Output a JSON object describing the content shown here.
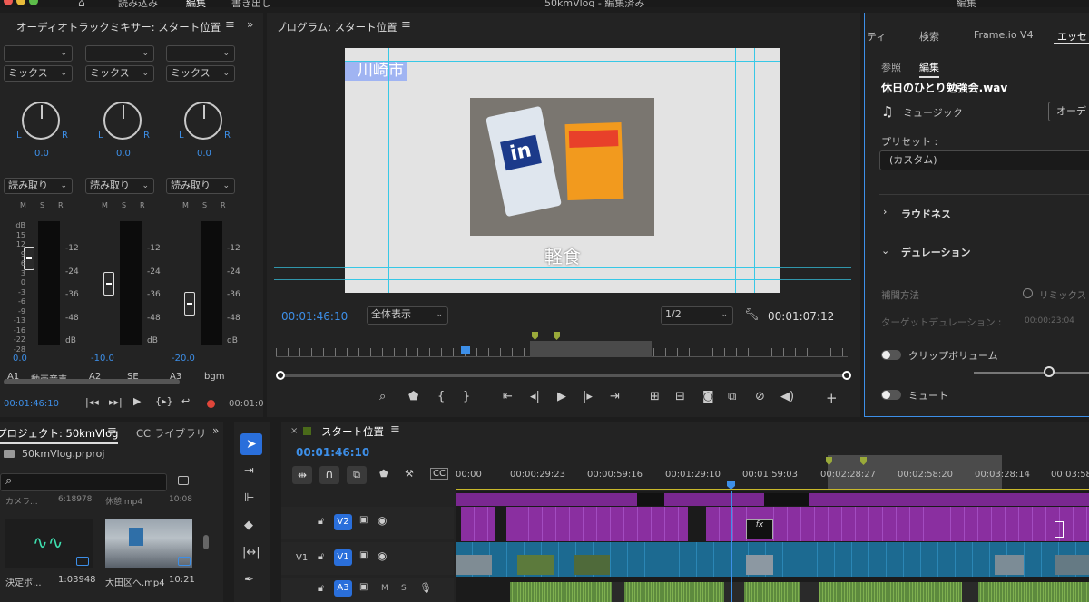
{
  "topbar": {
    "tabs": [
      "読み込み",
      "編集",
      "書き出し"
    ],
    "active_tab": "編集",
    "title": "50kmVlog - 編集済み",
    "right_label": "編集"
  },
  "mixer": {
    "title": "オーディオトラックミキサー: スタート位置",
    "mode_label": "ミックス",
    "read_label": "読み取り",
    "msr": [
      "M",
      "S",
      "R"
    ],
    "pan_values": [
      "0.0",
      "0.0",
      "0.0"
    ],
    "db_left": [
      "dB",
      "15",
      "12",
      "9",
      "6",
      "3",
      "0",
      "-3",
      "-6",
      "-9",
      "-13",
      "-16",
      "-22",
      "-28",
      "-oo"
    ],
    "db_right": [
      "-12",
      "-24",
      "-36",
      "-48",
      "dB"
    ],
    "channels": [
      {
        "volume": "0.0",
        "track": "A1",
        "name": "動画音声",
        "fader": 0.73
      },
      {
        "volume": "-10.0",
        "track": "A2",
        "name": "SE",
        "fader": 0.4
      },
      {
        "volume": "-20.0",
        "track": "A3",
        "name": "bgm",
        "fader": 0.15
      }
    ],
    "timecode": "00:01:46:10",
    "end_timecode": "00:01:0"
  },
  "program": {
    "title": "プログラム: スタート位置",
    "overlay_title": "川崎市",
    "caption": "軽食",
    "timecode": "00:01:46:10",
    "fit_label": "全体表示",
    "resolution": "1/2",
    "duration": "00:01:07:12",
    "playhead": 0.53
  },
  "essential": {
    "tabs": [
      "ティ",
      "検索",
      "Frame.io V4",
      "エッセ"
    ],
    "subtabs": [
      "参照",
      "編集"
    ],
    "filename": "休日のひとり勉強会.wav",
    "type_label": "ミュージック",
    "type_button": "オーデ",
    "preset_label": "プリセット :",
    "preset_value": "(カスタム)",
    "loudness": "ラウドネス",
    "duration_section": "デュレーション",
    "interp_label": "補間方法",
    "interp_option": "リミックス",
    "target_label": "ターゲットデュレーション :",
    "target_value": "00:00:23:04",
    "clip_volume": "クリップボリューム",
    "mute": "ミュート"
  },
  "project": {
    "tabs": [
      "プロジェクト: 50kmVlog",
      "CC ライブラリ"
    ],
    "file": "50kmVlog.prproj",
    "partial_labels": [
      "カメラ...",
      "6:18978",
      "休憩.mp4",
      "10:08"
    ],
    "items": [
      {
        "name": "決定ボ...",
        "meta": "1:03948"
      },
      {
        "name": "大田区へ.mp4",
        "meta": "10:21"
      }
    ]
  },
  "timeline": {
    "title": "スタート位置",
    "timecode": "00:01:46:10",
    "ruler": [
      "00:00",
      "00:00:29:23",
      "00:00:59:16",
      "00:01:29:10",
      "00:01:59:03",
      "00:02:28:27",
      "00:02:58:20",
      "00:03:28:14",
      "00:03:58"
    ],
    "tracks": [
      {
        "id": "V2",
        "label": "V2",
        "toggle": ""
      },
      {
        "id": "V1",
        "label": "V1",
        "toggle": "V1"
      },
      {
        "id": "A3",
        "label": "A3",
        "toggle": "",
        "extra": [
          "M",
          "S"
        ]
      }
    ],
    "playhead": 0.435
  },
  "colors": {
    "accent": "#3d8fe8",
    "v2_clip": "#8a2fa0",
    "v1_clip": "#1c6a91",
    "audio_clip": "#5d8a3e",
    "record": "#e0463a"
  }
}
